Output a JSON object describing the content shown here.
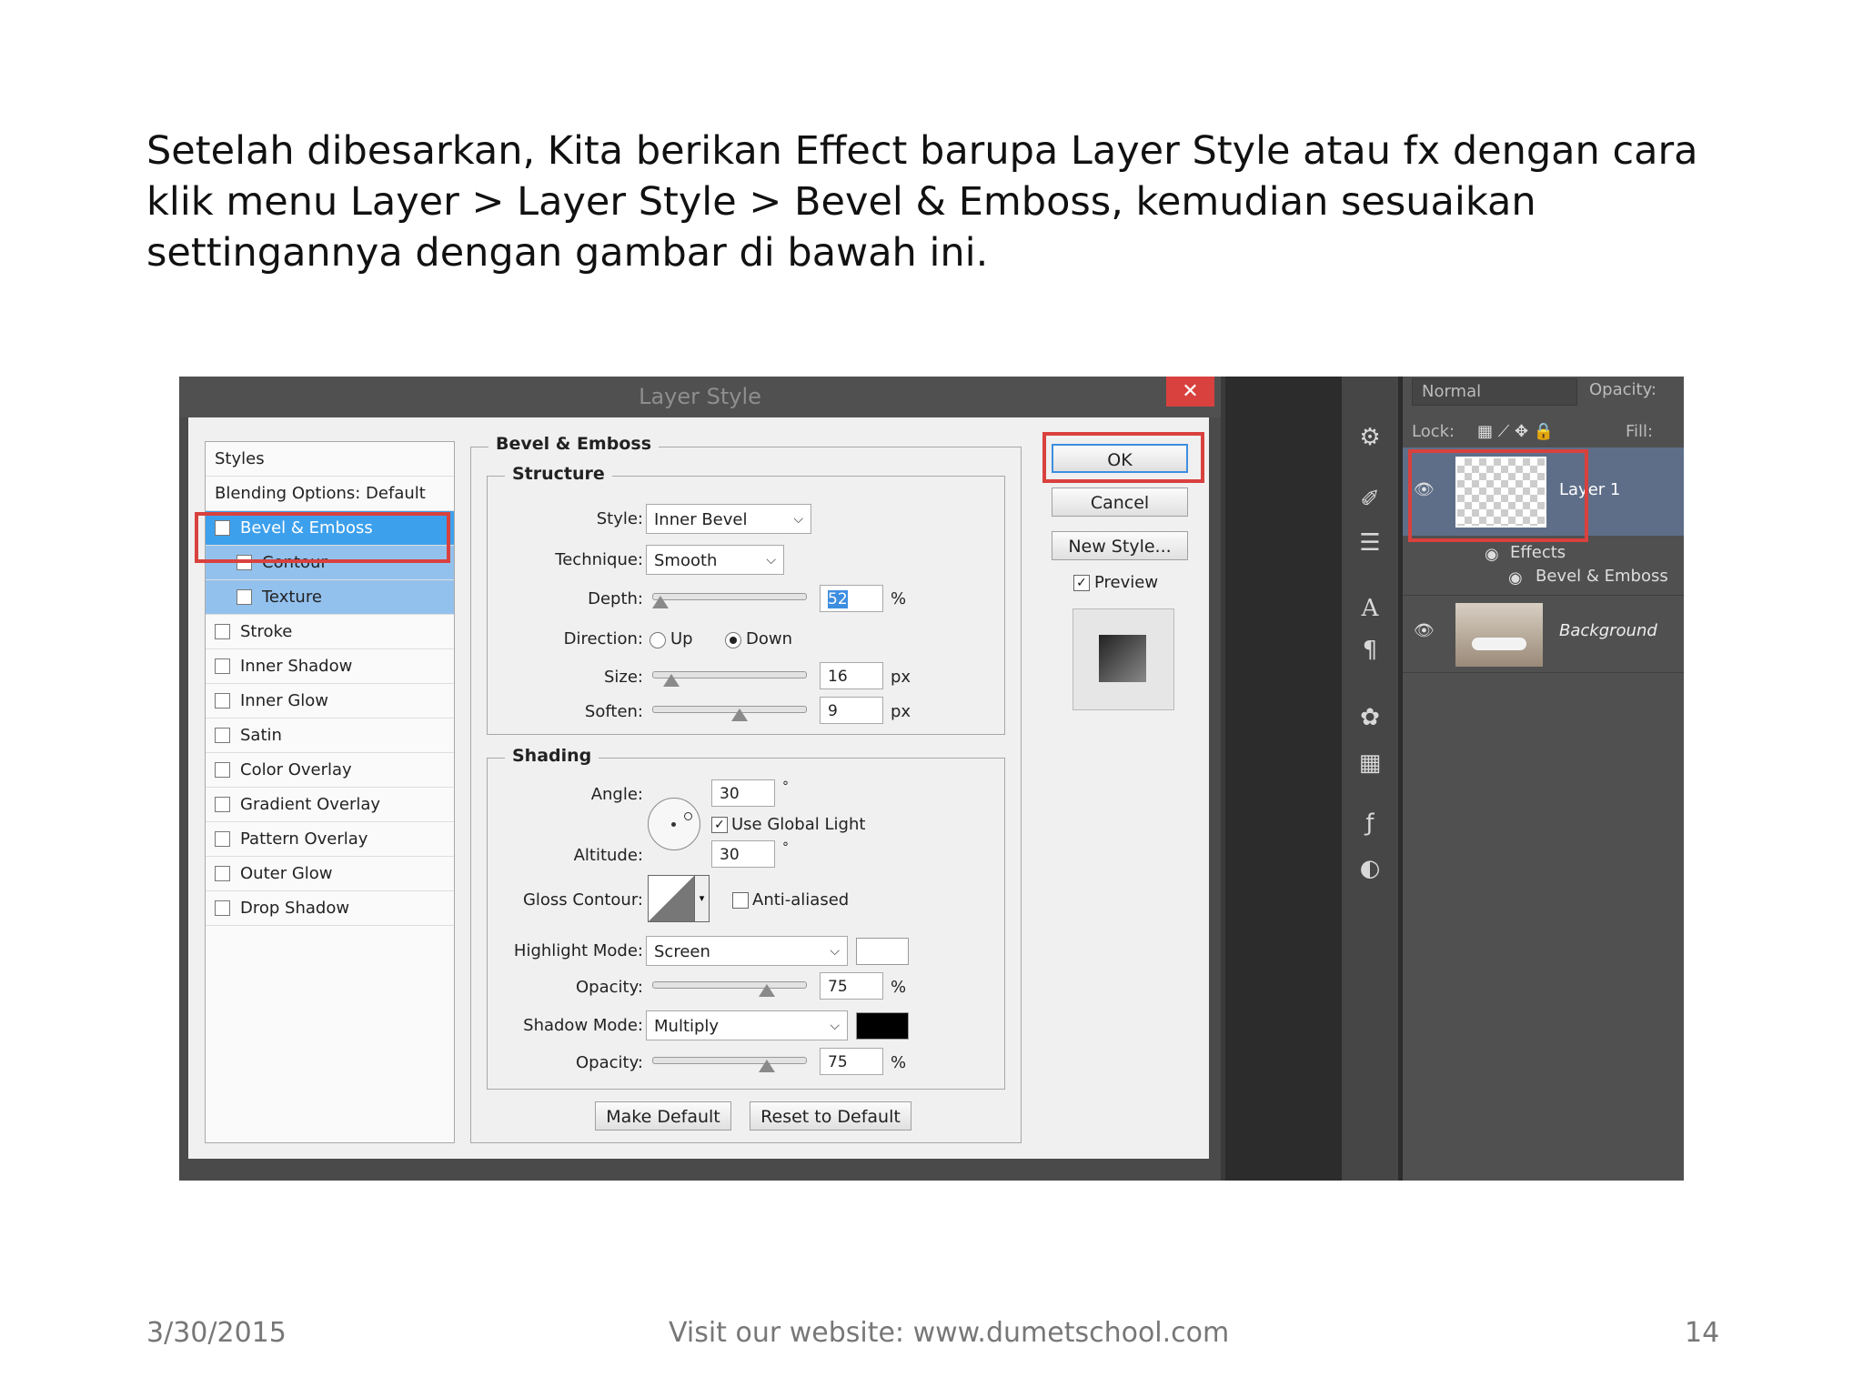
{
  "slide": {
    "paragraph": "Setelah dibesarkan, Kita berikan Effect barupa Layer Style atau fx dengan cara klik menu Layer > Layer Style > Bevel & Emboss, kemudian sesuaikan settingannya dengan gambar di bawah ini.",
    "footer_date": "3/30/2015",
    "footer_site": "Visit our website: www.dumetschool.com",
    "footer_page": "14"
  },
  "dialog": {
    "title": "Layer Style",
    "close_glyph": "✕",
    "styles_header": "Styles",
    "blending_options": "Blending Options: Default",
    "style_items": [
      {
        "label": "Bevel & Emboss",
        "checked": true
      },
      {
        "label": "Contour",
        "checked": false
      },
      {
        "label": "Texture",
        "checked": false
      },
      {
        "label": "Stroke",
        "checked": false
      },
      {
        "label": "Inner Shadow",
        "checked": false
      },
      {
        "label": "Inner Glow",
        "checked": false
      },
      {
        "label": "Satin",
        "checked": false
      },
      {
        "label": "Color Overlay",
        "checked": false
      },
      {
        "label": "Gradient Overlay",
        "checked": false
      },
      {
        "label": "Pattern Overlay",
        "checked": false
      },
      {
        "label": "Outer Glow",
        "checked": false
      },
      {
        "label": "Drop Shadow",
        "checked": false
      }
    ],
    "bevel": {
      "section_title": "Bevel & Emboss",
      "structure_title": "Structure",
      "style_label": "Style:",
      "style_value": "Inner Bevel",
      "technique_label": "Technique:",
      "technique_value": "Smooth",
      "depth_label": "Depth:",
      "depth_value": "52",
      "depth_unit": "%",
      "direction_label": "Direction:",
      "dir_up": "Up",
      "dir_down": "Down",
      "size_label": "Size:",
      "size_value": "16",
      "size_unit": "px",
      "soften_label": "Soften:",
      "soften_value": "9",
      "soften_unit": "px"
    },
    "shading": {
      "title": "Shading",
      "angle_label": "Angle:",
      "angle_value": "30",
      "degree": "°",
      "global_light": "Use Global Light",
      "altitude_label": "Altitude:",
      "altitude_value": "30",
      "gloss_label": "Gloss Contour:",
      "anti_aliased": "Anti-aliased",
      "highlight_label": "Highlight Mode:",
      "highlight_value": "Screen",
      "highlight_color": "#ffffff",
      "h_opacity_label": "Opacity:",
      "h_opacity_value": "75",
      "shadow_label": "Shadow Mode:",
      "shadow_value": "Multiply",
      "shadow_color": "#000000",
      "s_opacity_label": "Opacity:",
      "s_opacity_value": "75",
      "percent": "%"
    },
    "make_default": "Make Default",
    "reset_default": "Reset to Default",
    "ok": "OK",
    "cancel": "Cancel",
    "new_style": "New Style...",
    "preview": "Preview"
  },
  "layers_panel": {
    "blend_mode": "Normal",
    "opacity_label": "Opacity:",
    "lock_label": "Lock:",
    "fill_label": "Fill:",
    "layer1": "Layer 1",
    "effects": "Effects",
    "bevel_effect": "Bevel & Emboss",
    "background": "Background"
  },
  "colors": {
    "highlight_red": "#d9413e",
    "selection_blue": "#3da0ec"
  }
}
